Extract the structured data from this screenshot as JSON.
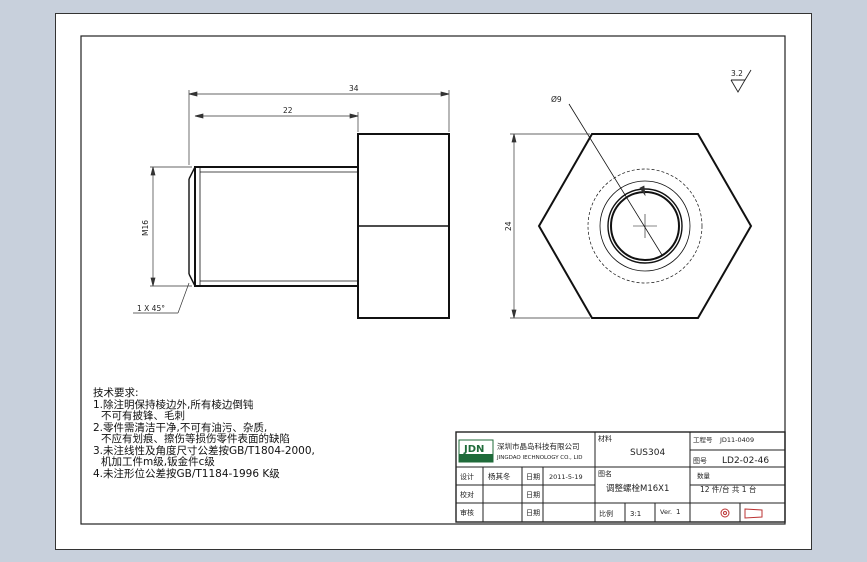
{
  "drawing": {
    "dimensions": {
      "overall_length": "34",
      "thread_length": "22",
      "thread_diameter": "M16",
      "chamfer": "1 X 45°",
      "hole_diameter": "Ø9",
      "across_flats": "24",
      "surface_roughness": "3.2"
    }
  },
  "notes": {
    "title": "技术要求:",
    "lines": [
      "1.除注明保持棱边外,所有棱边倒钝",
      "  不可有披锋、毛刺",
      "2.零件需清洁干净,不可有油污、杂质,",
      "  不应有划痕、擦伤等损伤零件表面的缺陷",
      "3.未注线性及角度尺寸公差按GB/T1804-2000,",
      "  机加工件m级,钣金件c级",
      "4.未注形位公差按GB/T1184-1996 K级"
    ]
  },
  "title_block": {
    "logo_text": "JDN",
    "company_cn": "深圳市晶岛科技有限公司",
    "company_en": "JINGDAO IECHNOLOGY CO., LID",
    "material_label": "材料",
    "material_value": "SUS304",
    "project_label": "工程号",
    "project_value": "JD11-0409",
    "drawing_no_label": "图号",
    "drawing_no_value": "LD2-02-46",
    "quantity_label": "数量",
    "quantity_value": "12 件/台    共 1 台",
    "design_label": "设计",
    "designer": "杨其冬",
    "date_label": "日期",
    "date_value": "2011-5-19",
    "check_label": "校对",
    "check_date_label": "日期",
    "approve_label": "审核",
    "approve_date_label": "日期",
    "part_name_label": "图名",
    "part_name_value": "调整螺栓M16X1",
    "scale_label": "比例",
    "scale_value": "3:1",
    "version_label": "Ver.",
    "version_value": "1"
  }
}
